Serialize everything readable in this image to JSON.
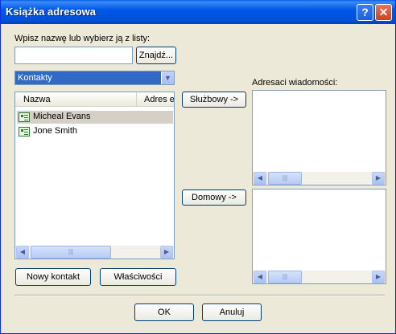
{
  "window": {
    "title": "Książka adresowa"
  },
  "titlebar": {
    "help_label": "?",
    "close_label": "✕"
  },
  "search": {
    "label": "Wpisz nazwę lub wybierz ją z listy:",
    "value": "",
    "find_button": "Znajdź..."
  },
  "source_select": {
    "selected": "Kontakty"
  },
  "contacts_list": {
    "columns": [
      "Nazwa",
      "Adres e"
    ],
    "rows": [
      {
        "name": "Micheal Evans",
        "selected": true
      },
      {
        "name": "Jone Smith",
        "selected": false
      }
    ]
  },
  "recipients": {
    "label": "Adresaci wiadomości:",
    "business_button": "Służbowy ->",
    "home_button": "Domowy ->"
  },
  "actions": {
    "new_contact": "Nowy kontakt",
    "properties": "Właściwości"
  },
  "footer": {
    "ok": "OK",
    "cancel": "Anuluj"
  },
  "colors": {
    "title_bar": "#0058e7",
    "dialog_bg": "#ece9d8",
    "selection": "#316ac5"
  },
  "icons": [
    "help-icon",
    "close-icon",
    "chevron-down-icon",
    "contact-card-icon",
    "arrow-left-icon",
    "arrow-right-icon",
    "scroll-thumb-grip"
  ]
}
